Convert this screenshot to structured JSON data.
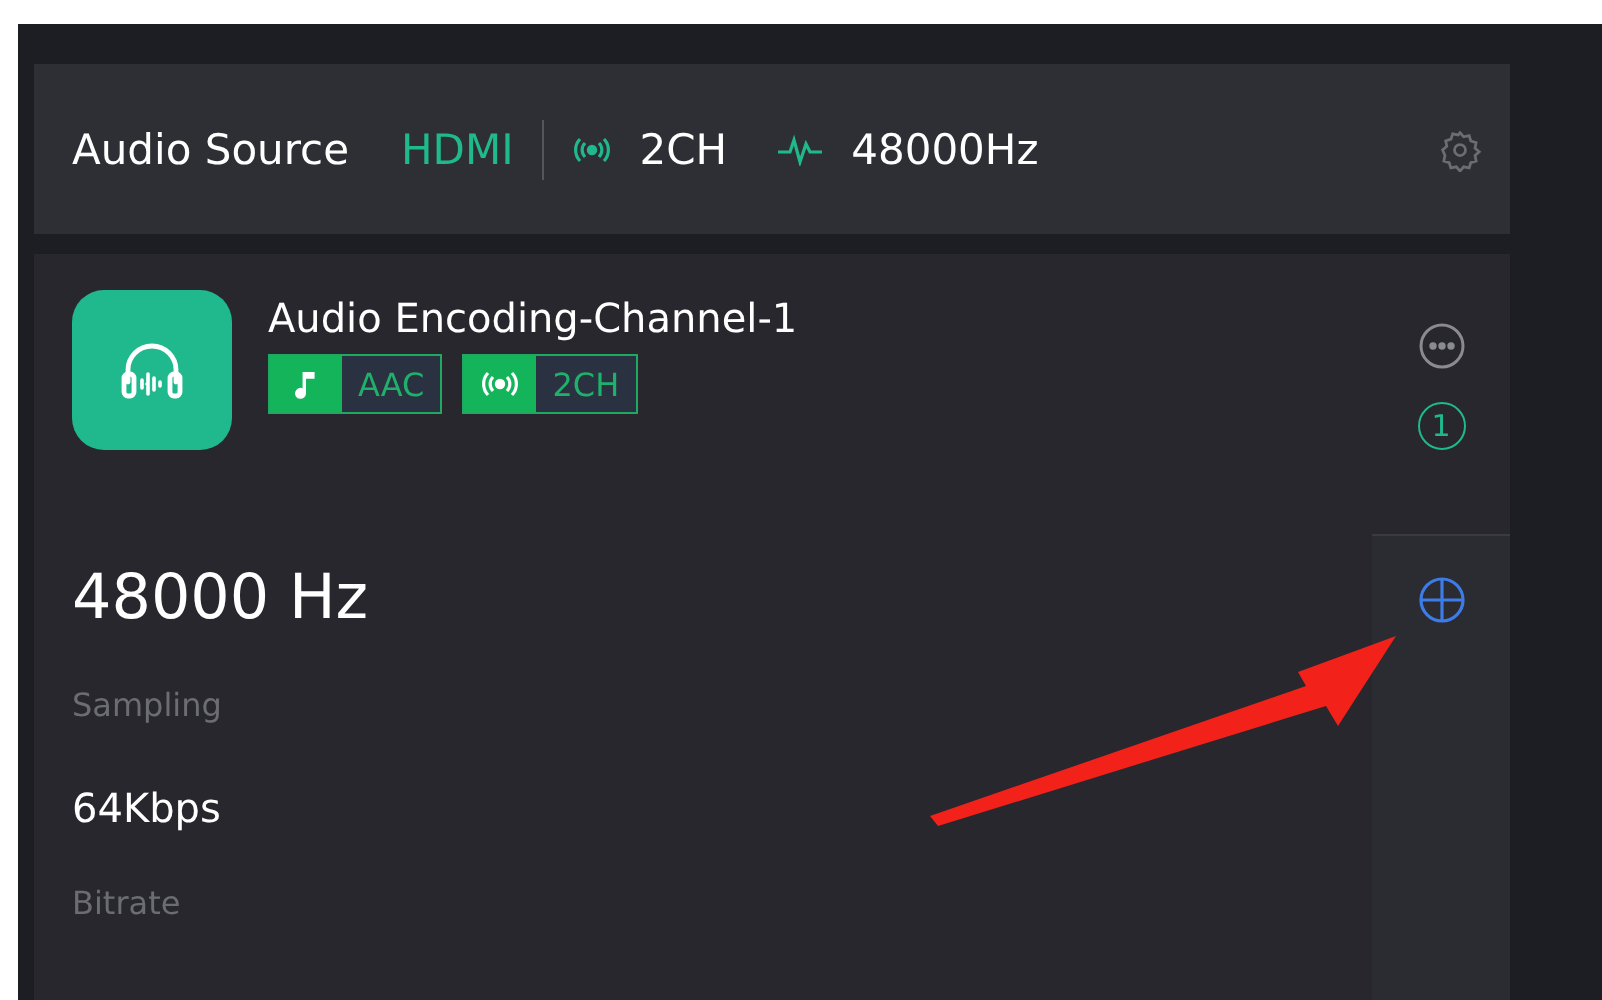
{
  "source_bar": {
    "label": "Audio Source",
    "interface": "HDMI",
    "channels": "2CH",
    "sample_rate": "48000Hz"
  },
  "channel_card": {
    "title": "Audio Encoding-Channel-1",
    "tags": [
      {
        "kind": "codec",
        "text": "AAC"
      },
      {
        "kind": "channels",
        "text": "2CH"
      }
    ],
    "badge": "1",
    "stats": [
      {
        "value": "48000 Hz",
        "label": "Sampling",
        "kind": "primary"
      },
      {
        "value": "64Kbps",
        "label": "Bitrate",
        "kind": "secondary"
      }
    ]
  }
}
